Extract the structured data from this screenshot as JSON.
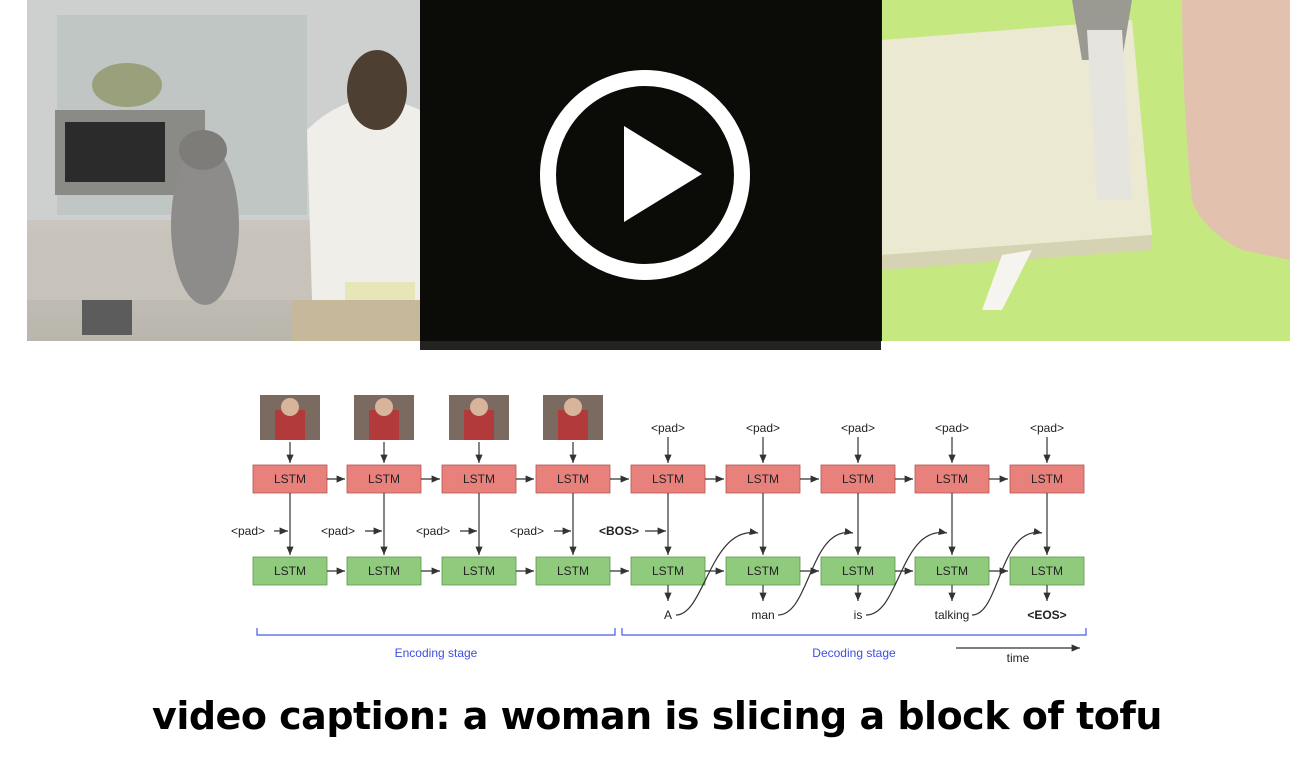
{
  "caption": "video caption: a woman is slicing a block of tofu",
  "diagram": {
    "encoder_pads": [
      "<pad>",
      "<pad>",
      "<pad>",
      "<pad>"
    ],
    "bos": "<BOS>",
    "decoder_pads": [
      "<pad>",
      "<pad>",
      "<pad>",
      "<pad>",
      "<pad>"
    ],
    "lstm_label": "LSTM",
    "outputs": [
      "A",
      "man",
      "is",
      "talking",
      "<EOS>"
    ],
    "encoding_stage": "Encoding stage",
    "decoding_stage": "Decoding stage",
    "time": "time"
  },
  "colors": {
    "lstm_top": "#e8817c",
    "lstm_bottom": "#8fca7d",
    "bracket": "#4a5ae0",
    "overlay": "#0a0a08"
  },
  "icons": {
    "play": "play-icon"
  }
}
